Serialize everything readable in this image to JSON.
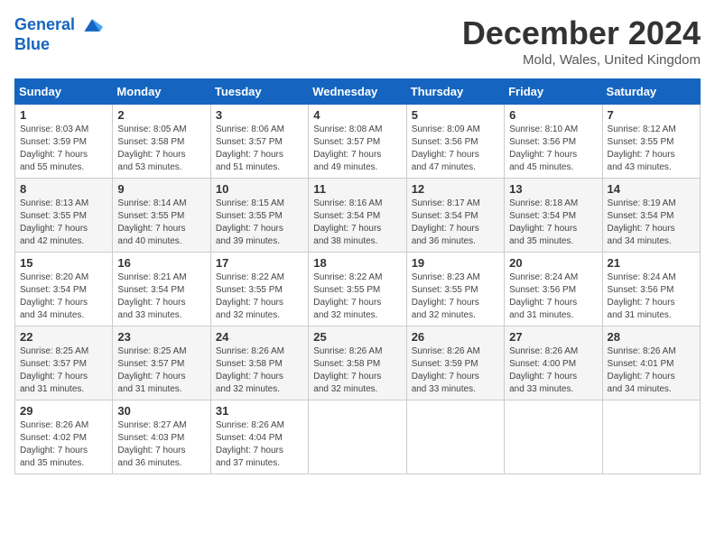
{
  "header": {
    "logo_line1": "General",
    "logo_line2": "Blue",
    "month_title": "December 2024",
    "location": "Mold, Wales, United Kingdom"
  },
  "days_of_week": [
    "Sunday",
    "Monday",
    "Tuesday",
    "Wednesday",
    "Thursday",
    "Friday",
    "Saturday"
  ],
  "weeks": [
    [
      {
        "day": "1",
        "info": "Sunrise: 8:03 AM\nSunset: 3:59 PM\nDaylight: 7 hours\nand 55 minutes."
      },
      {
        "day": "2",
        "info": "Sunrise: 8:05 AM\nSunset: 3:58 PM\nDaylight: 7 hours\nand 53 minutes."
      },
      {
        "day": "3",
        "info": "Sunrise: 8:06 AM\nSunset: 3:57 PM\nDaylight: 7 hours\nand 51 minutes."
      },
      {
        "day": "4",
        "info": "Sunrise: 8:08 AM\nSunset: 3:57 PM\nDaylight: 7 hours\nand 49 minutes."
      },
      {
        "day": "5",
        "info": "Sunrise: 8:09 AM\nSunset: 3:56 PM\nDaylight: 7 hours\nand 47 minutes."
      },
      {
        "day": "6",
        "info": "Sunrise: 8:10 AM\nSunset: 3:56 PM\nDaylight: 7 hours\nand 45 minutes."
      },
      {
        "day": "7",
        "info": "Sunrise: 8:12 AM\nSunset: 3:55 PM\nDaylight: 7 hours\nand 43 minutes."
      }
    ],
    [
      {
        "day": "8",
        "info": "Sunrise: 8:13 AM\nSunset: 3:55 PM\nDaylight: 7 hours\nand 42 minutes."
      },
      {
        "day": "9",
        "info": "Sunrise: 8:14 AM\nSunset: 3:55 PM\nDaylight: 7 hours\nand 40 minutes."
      },
      {
        "day": "10",
        "info": "Sunrise: 8:15 AM\nSunset: 3:55 PM\nDaylight: 7 hours\nand 39 minutes."
      },
      {
        "day": "11",
        "info": "Sunrise: 8:16 AM\nSunset: 3:54 PM\nDaylight: 7 hours\nand 38 minutes."
      },
      {
        "day": "12",
        "info": "Sunrise: 8:17 AM\nSunset: 3:54 PM\nDaylight: 7 hours\nand 36 minutes."
      },
      {
        "day": "13",
        "info": "Sunrise: 8:18 AM\nSunset: 3:54 PM\nDaylight: 7 hours\nand 35 minutes."
      },
      {
        "day": "14",
        "info": "Sunrise: 8:19 AM\nSunset: 3:54 PM\nDaylight: 7 hours\nand 34 minutes."
      }
    ],
    [
      {
        "day": "15",
        "info": "Sunrise: 8:20 AM\nSunset: 3:54 PM\nDaylight: 7 hours\nand 34 minutes."
      },
      {
        "day": "16",
        "info": "Sunrise: 8:21 AM\nSunset: 3:54 PM\nDaylight: 7 hours\nand 33 minutes."
      },
      {
        "day": "17",
        "info": "Sunrise: 8:22 AM\nSunset: 3:55 PM\nDaylight: 7 hours\nand 32 minutes."
      },
      {
        "day": "18",
        "info": "Sunrise: 8:22 AM\nSunset: 3:55 PM\nDaylight: 7 hours\nand 32 minutes."
      },
      {
        "day": "19",
        "info": "Sunrise: 8:23 AM\nSunset: 3:55 PM\nDaylight: 7 hours\nand 32 minutes."
      },
      {
        "day": "20",
        "info": "Sunrise: 8:24 AM\nSunset: 3:56 PM\nDaylight: 7 hours\nand 31 minutes."
      },
      {
        "day": "21",
        "info": "Sunrise: 8:24 AM\nSunset: 3:56 PM\nDaylight: 7 hours\nand 31 minutes."
      }
    ],
    [
      {
        "day": "22",
        "info": "Sunrise: 8:25 AM\nSunset: 3:57 PM\nDaylight: 7 hours\nand 31 minutes."
      },
      {
        "day": "23",
        "info": "Sunrise: 8:25 AM\nSunset: 3:57 PM\nDaylight: 7 hours\nand 31 minutes."
      },
      {
        "day": "24",
        "info": "Sunrise: 8:26 AM\nSunset: 3:58 PM\nDaylight: 7 hours\nand 32 minutes."
      },
      {
        "day": "25",
        "info": "Sunrise: 8:26 AM\nSunset: 3:58 PM\nDaylight: 7 hours\nand 32 minutes."
      },
      {
        "day": "26",
        "info": "Sunrise: 8:26 AM\nSunset: 3:59 PM\nDaylight: 7 hours\nand 33 minutes."
      },
      {
        "day": "27",
        "info": "Sunrise: 8:26 AM\nSunset: 4:00 PM\nDaylight: 7 hours\nand 33 minutes."
      },
      {
        "day": "28",
        "info": "Sunrise: 8:26 AM\nSunset: 4:01 PM\nDaylight: 7 hours\nand 34 minutes."
      }
    ],
    [
      {
        "day": "29",
        "info": "Sunrise: 8:26 AM\nSunset: 4:02 PM\nDaylight: 7 hours\nand 35 minutes."
      },
      {
        "day": "30",
        "info": "Sunrise: 8:27 AM\nSunset: 4:03 PM\nDaylight: 7 hours\nand 36 minutes."
      },
      {
        "day": "31",
        "info": "Sunrise: 8:26 AM\nSunset: 4:04 PM\nDaylight: 7 hours\nand 37 minutes."
      },
      {
        "day": "",
        "info": ""
      },
      {
        "day": "",
        "info": ""
      },
      {
        "day": "",
        "info": ""
      },
      {
        "day": "",
        "info": ""
      }
    ]
  ]
}
